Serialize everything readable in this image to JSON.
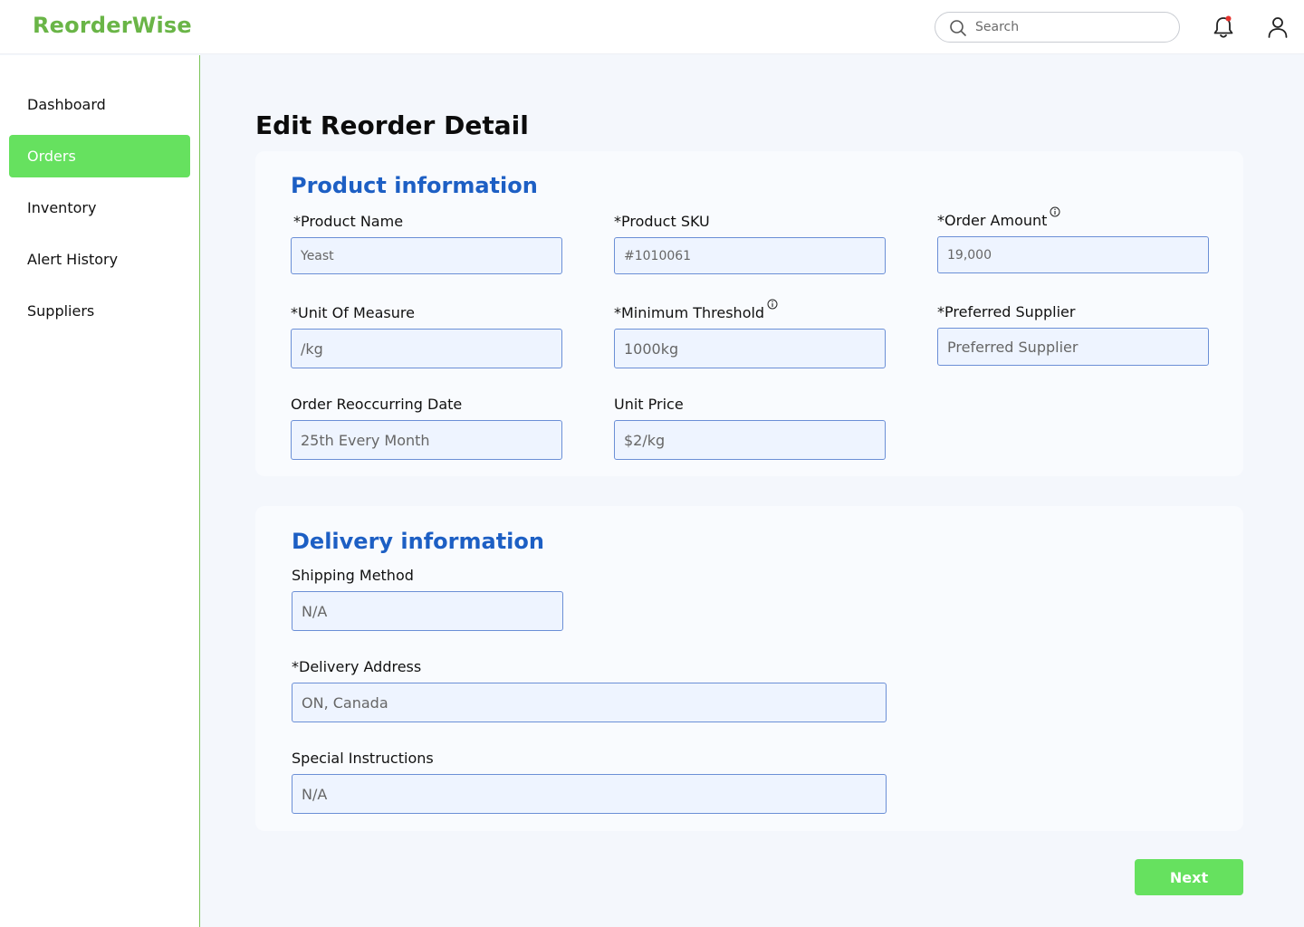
{
  "app": {
    "name": "ReorderWise"
  },
  "header": {
    "search_placeholder": "Search",
    "bell_icon": "bell-icon",
    "notification_dot_color": "#e5322d",
    "user_icon": "user-icon"
  },
  "sidebar": {
    "items": [
      {
        "label": "Dashboard",
        "active": false
      },
      {
        "label": "Orders",
        "active": true
      },
      {
        "label": "Inventory",
        "active": false
      },
      {
        "label": "Alert History",
        "active": false
      },
      {
        "label": "Suppliers",
        "active": false
      }
    ]
  },
  "page": {
    "title": "Edit Reorder Detail"
  },
  "product_info": {
    "title": "Product information",
    "product_name": {
      "label": "*Product Name",
      "placeholder": "Yeast"
    },
    "product_sku": {
      "label": "*Product SKU",
      "placeholder": "#1010061"
    },
    "order_amount": {
      "label": "*Order Amount",
      "placeholder": "19,000"
    },
    "unit_of_measure": {
      "label": "*Unit Of Measure",
      "placeholder": "/kg"
    },
    "minimum_threshold": {
      "label": "*Minimum Threshold",
      "placeholder": "1000kg"
    },
    "preferred_supplier": {
      "label": "*Preferred Supplier",
      "placeholder": "Preferred Supplier"
    },
    "reoccurring_date": {
      "label": "Order Reoccurring Date",
      "placeholder": "25th Every Month"
    },
    "unit_price": {
      "label": "Unit Price",
      "placeholder": "$2/kg"
    }
  },
  "delivery_info": {
    "title": "Delivery information",
    "shipping_method": {
      "label": "Shipping Method",
      "placeholder": "N/A"
    },
    "delivery_address": {
      "label": "*Delivery Address",
      "placeholder": "ON, Canada"
    },
    "special_instructions": {
      "label": "Special Instructions",
      "placeholder": "N/A"
    }
  },
  "actions": {
    "next_label": "Next"
  },
  "colors": {
    "brand": "#6ab547",
    "accent_green": "#66e15f",
    "section_title": "#1d5fc4",
    "input_bg": "#eef4ff",
    "input_border": "#6b8fd6"
  }
}
